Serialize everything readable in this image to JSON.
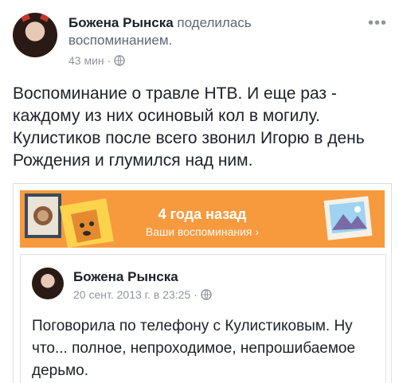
{
  "post": {
    "author": "Божена Рынска",
    "action": "поделилась воспоминанием.",
    "time": "43 мин",
    "dot": "·",
    "menu": "•••",
    "text": "Воспоминание о травле НТВ. И еще раз - каждому из них осиновый кол в могилу. Кулистиков после всего звонил Игорю в день Рождения и глумился над ним."
  },
  "memory": {
    "title": "4 года назад",
    "subtitle": "Ваши воспоминания ›",
    "accent_color": "#f79a3e"
  },
  "shared_post": {
    "author": "Божена Рынска",
    "date": "20 сент. 2013 г. в 23:25",
    "dot": "·",
    "text": "Поговорила по телефону с Кулистиковым. Ну что... полное, непроходимое, непрошибаемое дерьмо."
  },
  "icons": {
    "privacy": "globe-icon",
    "options": "more-options-icon"
  }
}
